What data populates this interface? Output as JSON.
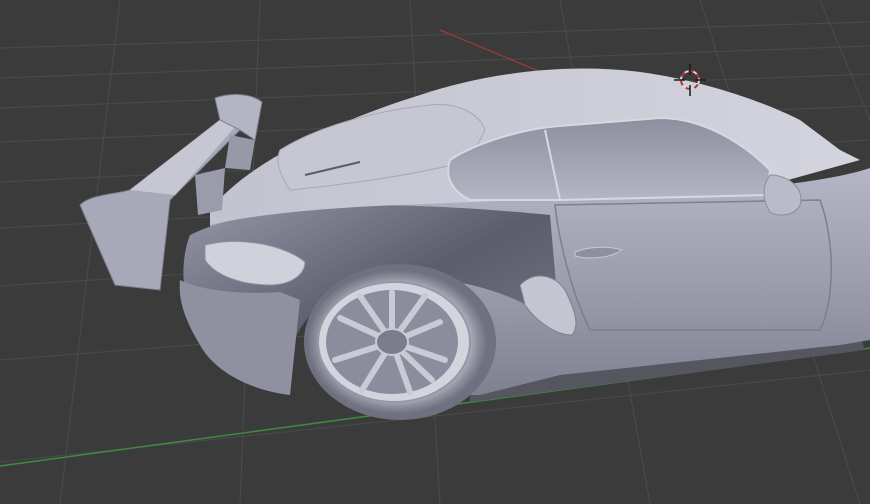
{
  "viewport": {
    "background": "#3b3b3b",
    "grid_color": "#4a4a4a",
    "x_axis_color": "#9a3838",
    "y_axis_color": "#3e8a3e",
    "object": "car-model-mesh",
    "material": "solid-grey-clay",
    "cursor_icon": "3d-cursor-icon"
  }
}
